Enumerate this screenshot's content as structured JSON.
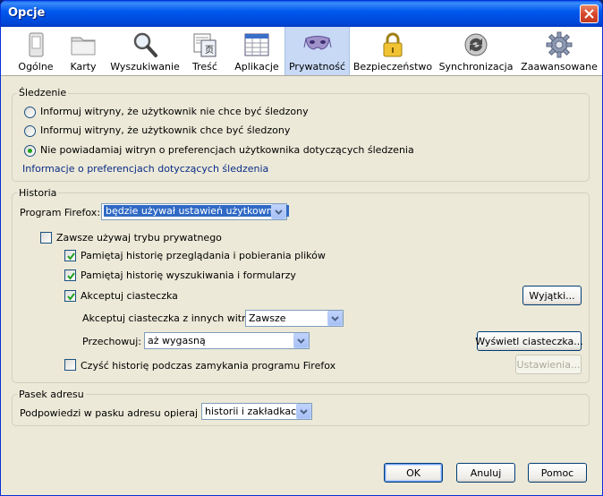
{
  "window": {
    "title": "Opcje"
  },
  "tabs": [
    {
      "label": "Ogólne",
      "icon": "general-icon"
    },
    {
      "label": "Karty",
      "icon": "tabs-icon"
    },
    {
      "label": "Wyszukiwanie",
      "icon": "search-icon"
    },
    {
      "label": "Treść",
      "icon": "content-icon"
    },
    {
      "label": "Aplikacje",
      "icon": "applications-icon"
    },
    {
      "label": "Prywatność",
      "icon": "privacy-mask-icon",
      "selected": true
    },
    {
      "label": "Bezpieczeństwo",
      "icon": "padlock-icon"
    },
    {
      "label": "Synchronizacja",
      "icon": "sync-icon"
    },
    {
      "label": "Zaawansowane",
      "icon": "gear-icon"
    }
  ],
  "tracking": {
    "label": "Śledzenie",
    "options": [
      {
        "label": "Informuj witryny, że użytkownik nie chce być śledzony",
        "checked": false
      },
      {
        "label": "Informuj witryny, że użytkownik chce być śledzony",
        "checked": false
      },
      {
        "label": "Nie powiadamiaj witryn o preferencjach użytkownika dotyczących śledzenia",
        "checked": true
      }
    ],
    "info_link": "Informacje o preferencjach dotyczących śledzenia"
  },
  "history": {
    "label": "Historia",
    "mode_label": "Program Firefox:",
    "mode_value": "będzie używał ustawień użytkownika",
    "private_mode": {
      "label": "Zawsze używaj trybu prywatnego",
      "checked": false
    },
    "remember_browsing": {
      "label": "Pamiętaj historię przeglądania i pobierania plików",
      "checked": true
    },
    "remember_search": {
      "label": "Pamiętaj historię wyszukiwania i formularzy",
      "checked": true
    },
    "accept_cookies": {
      "label": "Akceptuj ciasteczka",
      "checked": true
    },
    "exceptions_button": "Wyjątki...",
    "third_party_label": "Akceptuj ciasteczka z innych witryn:",
    "third_party_value": "Zawsze",
    "keep_label": "Przechowuj:",
    "keep_value": "aż wygasną",
    "show_cookies_button": "Wyświetl ciasteczka...",
    "clear_on_close": {
      "label": "Czyść historię podczas zamykania programu Firefox",
      "checked": false
    },
    "settings_button": "Ustawienia..."
  },
  "location_bar": {
    "label": "Pasek adresu",
    "suggest_label": "Podpowiedzi w pasku adresu opieraj na:",
    "suggest_value": "historii i zakładkach"
  },
  "buttons": {
    "ok": "OK",
    "cancel": "Anuluj",
    "help": "Pomoc"
  },
  "colors": {
    "titlebar": "#0058ee",
    "selected_tab": "#c7d9f5",
    "link": "#0b2c88",
    "dialog_bg": "#ece9d8"
  }
}
